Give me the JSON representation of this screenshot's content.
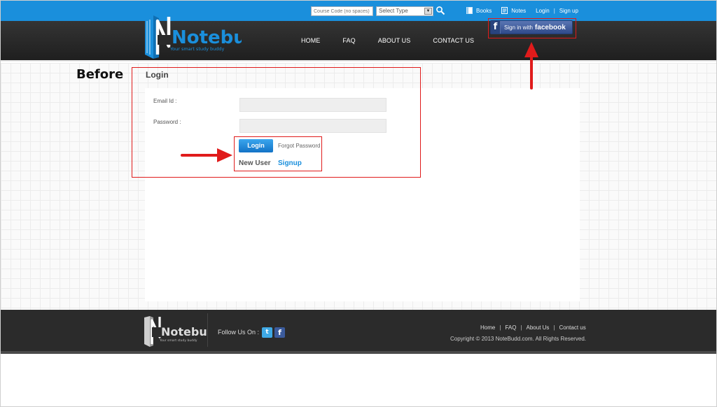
{
  "topbar": {
    "course_placeholder": "Course Code (no spaces)",
    "type_select": "Select Type",
    "links": [
      "Books",
      "Notes",
      "Login",
      "Sign up"
    ],
    "link_separator": "|"
  },
  "header": {
    "logo_text": "Notebudd",
    "logo_tagline": "Your smart study buddy",
    "nav": [
      "HOME",
      "FAQ",
      "ABOUT US",
      "CONTACT US"
    ],
    "facebook": {
      "prefix": "Sign in with",
      "brand": "facebook"
    }
  },
  "annotation": {
    "label": "Before"
  },
  "login": {
    "title": "Login",
    "email_label": "Email Id :",
    "password_label": "Password :",
    "login_button": "Login",
    "forgot": "Forgot Password",
    "new_user": "New User",
    "signup": "Signup"
  },
  "footer": {
    "logo_text": "Notebudd",
    "logo_tagline": "Your smart study buddy",
    "follow": "Follow Us On :",
    "links": [
      "Home",
      "FAQ",
      "About Us",
      "Contact us"
    ],
    "link_separator": "|",
    "copyright": "Copyright © 2013 NoteBudd.com. All Rights Reserved."
  },
  "colors": {
    "topbar": "#1a8fdc",
    "header": "#2a2a2a",
    "annotation_red": "#e01b1b",
    "facebook": "#3b5b9c",
    "twitter": "#3fa9e5"
  },
  "icons": [
    "search-icon",
    "book-icon",
    "notes-icon",
    "facebook-icon",
    "twitter-icon",
    "arrow-icon"
  ]
}
